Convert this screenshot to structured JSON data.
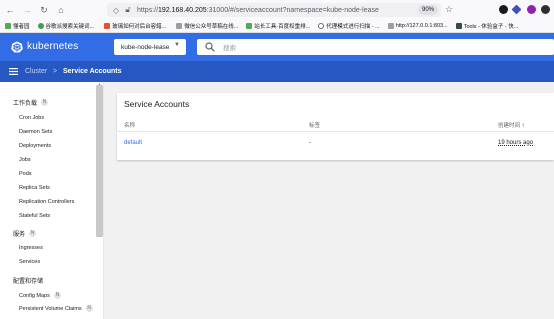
{
  "browser": {
    "url_prefix": "https://",
    "url_host": "192.168.40.205",
    "url_rest": ":31000/#/serviceaccount?namespace=kube-node-lease",
    "zoom": "90%",
    "bookmarks": [
      {
        "label": "懂者园",
        "color": "#4caf50"
      },
      {
        "label": "谷歌派搜索关键词...",
        "color": "#3fa14a"
      },
      {
        "label": "玻璃如何对后台容錯...",
        "color": "#e8512c"
      },
      {
        "label": "微信公众号草稿在线...",
        "color": "#9e9e9e"
      },
      {
        "label": "站长工具-百度权重排...",
        "color": "#4caf50"
      },
      {
        "label": "代理模式进行扫描 - ...",
        "color": "#6d6d6d"
      },
      {
        "label": "http://127.0.0.1:803...",
        "color": "#9e9e9e"
      },
      {
        "label": "Tools - 休验盒子 - 快...",
        "color": "#37474f"
      }
    ]
  },
  "header": {
    "brand": "kubernetes",
    "namespace": "kube-node-lease",
    "search_placeholder": "搜索"
  },
  "breadcrumb": {
    "cluster": "Cluster",
    "separator": ">",
    "current": "Service Accounts"
  },
  "sidebar": {
    "workloads_title": "工作负载",
    "workloads_badge": "N",
    "workloads": [
      "Cron Jobs",
      "Daemon Sets",
      "Deployments",
      "Jobs",
      "Pods",
      "Replica Sets",
      "Replication Controllers",
      "Stateful Sets"
    ],
    "service_title": "服务",
    "service_badge": "N",
    "services": [
      "Ingresses",
      "Services"
    ],
    "config_title": "配置和存储",
    "config_items": [
      "Config Maps",
      "Persistent Volume Claims"
    ],
    "config_badges": [
      "N",
      "N"
    ]
  },
  "card": {
    "title": "Service Accounts",
    "columns": {
      "name": "名称",
      "labels": "标签",
      "created": "创建时间",
      "sort_arrow": "↑"
    },
    "rows": [
      {
        "name": "default",
        "labels": "-",
        "created": "19 hours ago"
      }
    ]
  },
  "colors": {
    "primary": "#326de6",
    "subheader": "#2758c2"
  }
}
